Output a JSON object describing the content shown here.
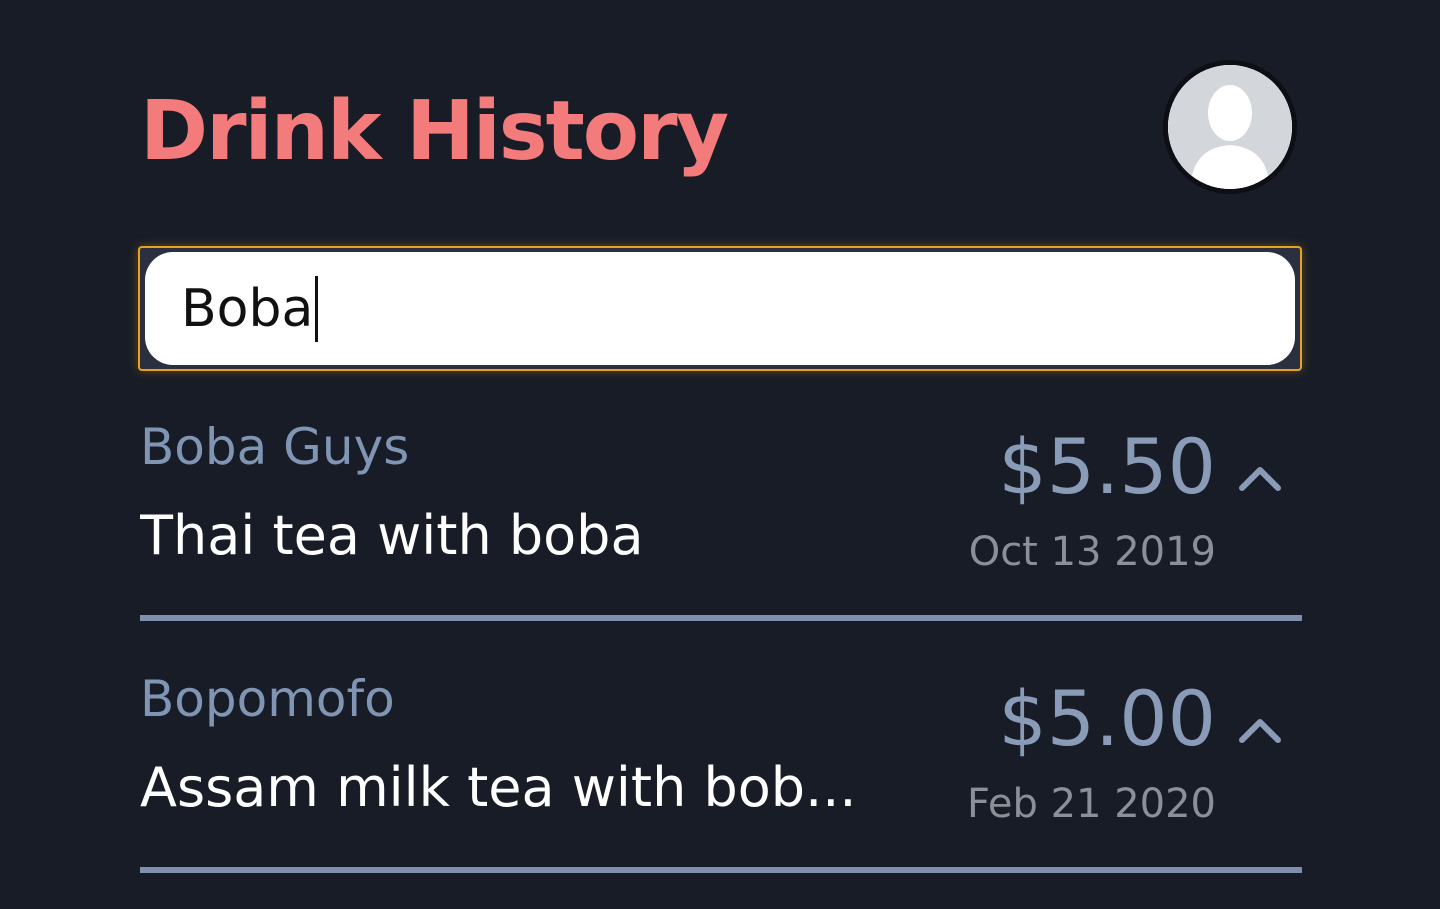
{
  "header": {
    "title": "Drink History",
    "avatar_icon": "user-silhouette-icon"
  },
  "search": {
    "value": "Boba",
    "focused": true
  },
  "entries": [
    {
      "shop": "Boba Guys",
      "drink": "Thai tea with boba",
      "price": "$5.50",
      "date": "Oct 13 2019",
      "toggle_icon": "chevron-up-icon"
    },
    {
      "shop": "Bopomofo",
      "drink": "Assam milk tea with bob...",
      "price": "$5.00",
      "date": "Feb 21 2020",
      "toggle_icon": "chevron-up-icon"
    }
  ],
  "colors": {
    "background": "#181c26",
    "title": "#f47b7b",
    "accent_focus": "#e8a21e",
    "muted_text": "#8094b3",
    "divider": "#7e90ad"
  }
}
